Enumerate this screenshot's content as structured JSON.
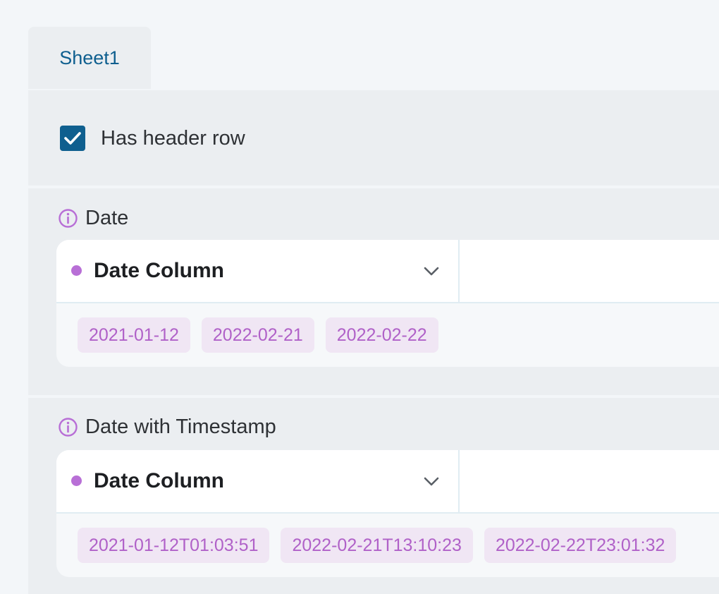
{
  "tabs": [
    {
      "label": "Sheet1"
    }
  ],
  "header_option": {
    "label": "Has header row",
    "checked": true
  },
  "columns": [
    {
      "title": "Date",
      "type_select": {
        "value": "Date Column"
      },
      "samples": [
        "2021-01-12",
        "2022-02-21",
        "2022-02-22"
      ]
    },
    {
      "title": "Date with Timestamp",
      "type_select": {
        "value": "Date Column"
      },
      "samples": [
        "2021-01-12T01:03:51",
        "2022-02-21T13:10:23",
        "2022-02-22T23:01:32"
      ]
    }
  ],
  "colors": {
    "accent": "#0f5f8f",
    "type_dot": "#b86fd6",
    "chip_text": "#b061c8",
    "chip_bg": "#f0e6f4"
  },
  "icons": {
    "checkbox": "checkmark-icon",
    "column_info": "info-icon",
    "select": "chevron-down-icon"
  }
}
